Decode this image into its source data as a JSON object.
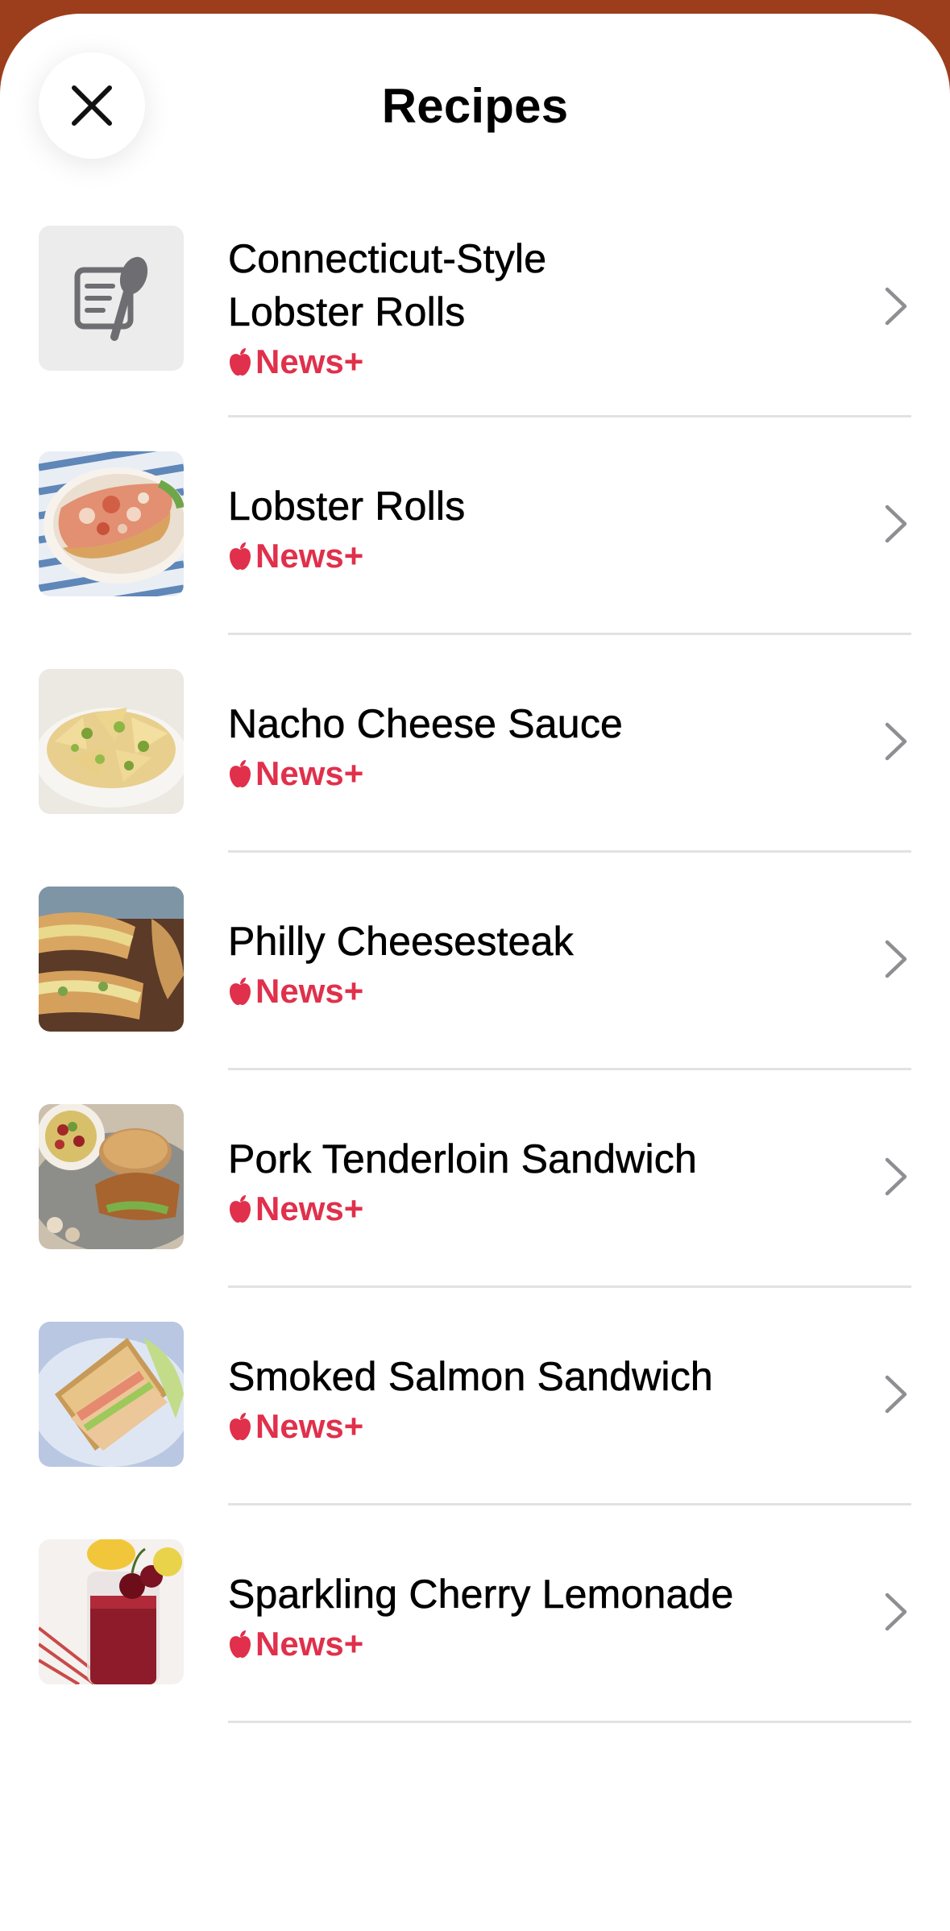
{
  "header": {
    "title": "Recipes",
    "close_label": "Close"
  },
  "colors": {
    "backdrop": "#9c3e1c",
    "accent": "#e0304b",
    "divider": "#e2e2e4"
  },
  "icons": {
    "close": "xmark-icon",
    "placeholder": "recipe-document-icon",
    "source_logo": "apple-logo-icon",
    "disclosure": "chevron-right-icon"
  },
  "recipes": [
    {
      "title_line1": "Connecticut-Style",
      "title_line2": "Lobster Rolls",
      "source": "News+",
      "thumb": "placeholder"
    },
    {
      "title_line1": "Lobster Rolls",
      "title_line2": "",
      "source": "News+",
      "thumb": "lobster"
    },
    {
      "title_line1": "Nacho Cheese Sauce",
      "title_line2": "",
      "source": "News+",
      "thumb": "nachos"
    },
    {
      "title_line1": "Philly Cheesesteak",
      "title_line2": "",
      "source": "News+",
      "thumb": "cheesesteak"
    },
    {
      "title_line1": "Pork Tenderloin Sandwich",
      "title_line2": "",
      "source": "News+",
      "thumb": "pork"
    },
    {
      "title_line1": "Smoked Salmon Sandwich",
      "title_line2": "",
      "source": "News+",
      "thumb": "salmon"
    },
    {
      "title_line1": "Sparkling Cherry Lemonade",
      "title_line2": "",
      "source": "News+",
      "thumb": "lemonade"
    }
  ]
}
